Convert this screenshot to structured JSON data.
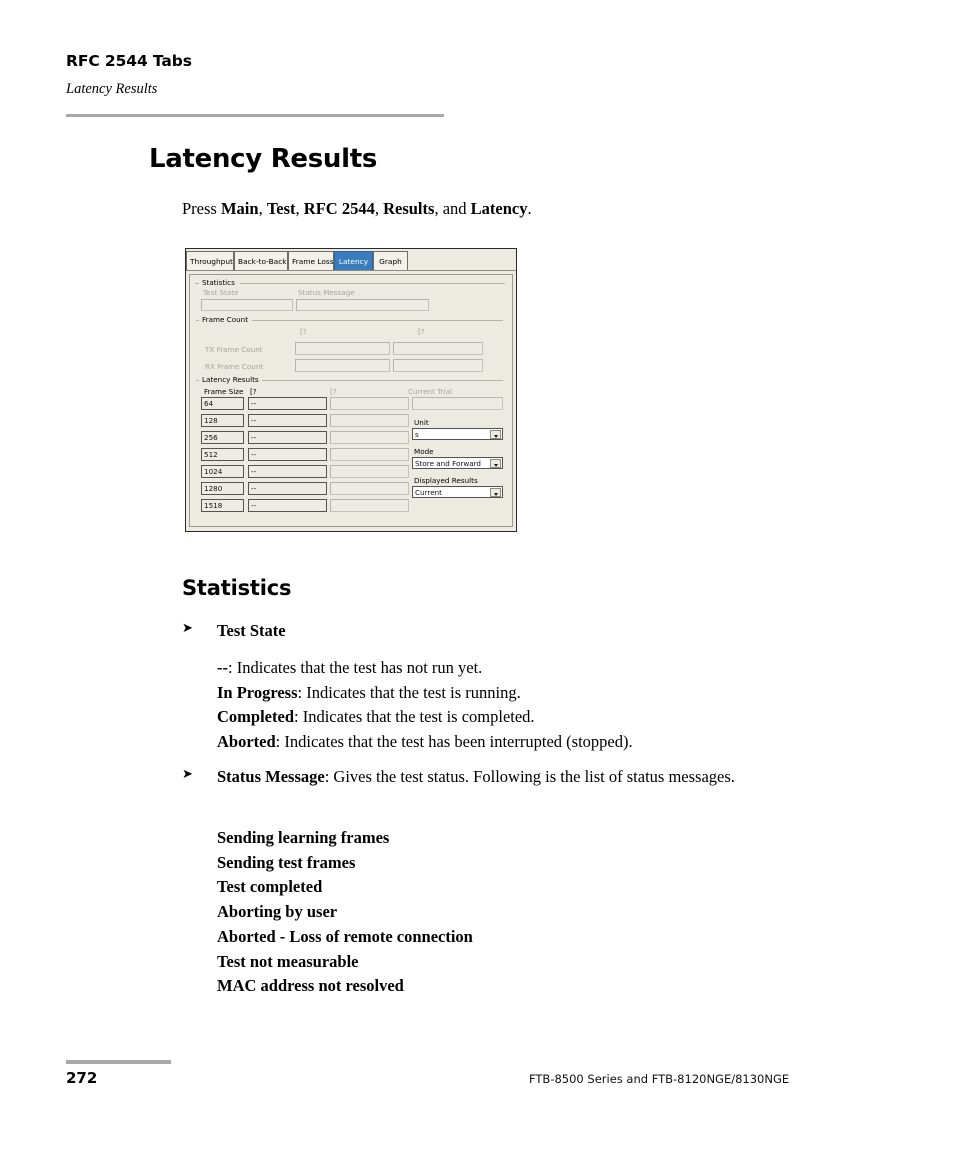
{
  "header": {
    "running_title": "RFC 2544 Tabs",
    "running_subtitle": "Latency Results"
  },
  "page_title": "Latency Results",
  "intro": {
    "prefix": "Press ",
    "step1": "Main",
    "sep1": ", ",
    "step2": "Test",
    "sep2": ", ",
    "step3": "RFC 2544",
    "sep3": ", ",
    "step4": "Results",
    "sep4": ", and ",
    "step5": "Latency",
    "suffix": "."
  },
  "screenshot": {
    "tabs": [
      {
        "label": "Throughput",
        "selected": false
      },
      {
        "label": "Back-to-Back",
        "selected": false
      },
      {
        "label": "Frame Loss",
        "selected": false
      },
      {
        "label": "Latency",
        "selected": true
      },
      {
        "label": "Graph",
        "selected": false
      }
    ],
    "selected_tab_color": "#3A7DBE",
    "panel_background": "#ECEAE1",
    "statistics_group": {
      "title": "Statistics",
      "test_state_label": "Test State",
      "test_state_value": "",
      "status_message_label": "Status Message",
      "status_message_value": ""
    },
    "frame_count_group": {
      "title": "Frame Count",
      "col_header_1": "[?",
      "col_header_2": "[?",
      "tx_label": "TX Frame Count",
      "rx_label": "RX Frame Count",
      "tx_value_1": "",
      "tx_value_2": "",
      "rx_value_1": "",
      "rx_value_2": ""
    },
    "latency_results_group": {
      "title": "Latency Results",
      "columns": [
        "Frame Size",
        "[?",
        "[?",
        "Current Trial"
      ],
      "rows": [
        {
          "frame_size": "64",
          "value": "--"
        },
        {
          "frame_size": "128",
          "value": "--"
        },
        {
          "frame_size": "256",
          "value": "--"
        },
        {
          "frame_size": "512",
          "value": "--"
        },
        {
          "frame_size": "1024",
          "value": "--"
        },
        {
          "frame_size": "1280",
          "value": "--"
        },
        {
          "frame_size": "1518",
          "value": "--"
        }
      ],
      "controls": [
        {
          "label": "Unit",
          "value": "s"
        },
        {
          "label": "Mode",
          "value": "Store and Forward"
        },
        {
          "label": "Displayed Results",
          "value": "Current"
        }
      ]
    }
  },
  "statistics_section": {
    "heading": "Statistics",
    "test_state": {
      "bullet_label": "Test State",
      "definitions": [
        {
          "term": "--",
          "text": ": Indicates that the test has not run yet."
        },
        {
          "term": "In Progress",
          "text": ": Indicates that the test is running."
        },
        {
          "term": "Completed",
          "text": ": Indicates that the test is completed."
        },
        {
          "term": "Aborted",
          "text": ": Indicates that the test has been interrupted (stopped)."
        }
      ]
    },
    "status_message": {
      "bullet_term": "Status Message",
      "bullet_text": ": Gives the test status. Following is the list of status messages.",
      "messages": [
        "Sending learning frames",
        "Sending test frames",
        "Test completed",
        "Aborting by user",
        "Aborted - Loss of remote connection",
        "Test not measurable",
        "MAC address not resolved"
      ]
    }
  },
  "footer": {
    "page_number": "272",
    "product_line": "FTB-8500 Series and FTB-8120NGE/8130NGE"
  }
}
